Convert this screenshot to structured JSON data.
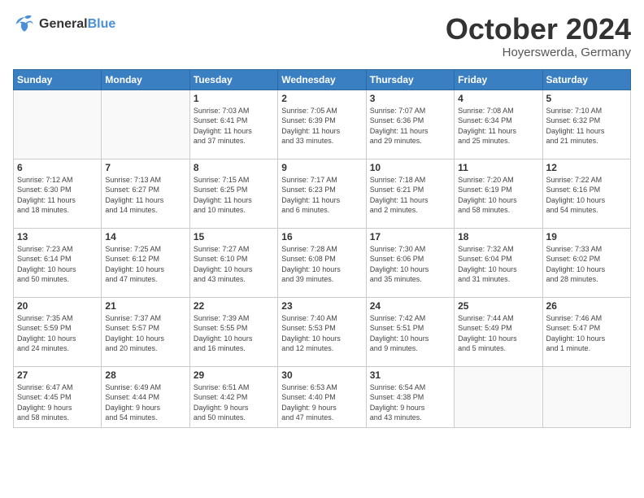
{
  "header": {
    "logo_line1": "General",
    "logo_line2": "Blue",
    "month": "October 2024",
    "location": "Hoyerswerda, Germany"
  },
  "days_of_week": [
    "Sunday",
    "Monday",
    "Tuesday",
    "Wednesday",
    "Thursday",
    "Friday",
    "Saturday"
  ],
  "weeks": [
    [
      {
        "day": "",
        "info": ""
      },
      {
        "day": "",
        "info": ""
      },
      {
        "day": "1",
        "info": "Sunrise: 7:03 AM\nSunset: 6:41 PM\nDaylight: 11 hours\nand 37 minutes."
      },
      {
        "day": "2",
        "info": "Sunrise: 7:05 AM\nSunset: 6:39 PM\nDaylight: 11 hours\nand 33 minutes."
      },
      {
        "day": "3",
        "info": "Sunrise: 7:07 AM\nSunset: 6:36 PM\nDaylight: 11 hours\nand 29 minutes."
      },
      {
        "day": "4",
        "info": "Sunrise: 7:08 AM\nSunset: 6:34 PM\nDaylight: 11 hours\nand 25 minutes."
      },
      {
        "day": "5",
        "info": "Sunrise: 7:10 AM\nSunset: 6:32 PM\nDaylight: 11 hours\nand 21 minutes."
      }
    ],
    [
      {
        "day": "6",
        "info": "Sunrise: 7:12 AM\nSunset: 6:30 PM\nDaylight: 11 hours\nand 18 minutes."
      },
      {
        "day": "7",
        "info": "Sunrise: 7:13 AM\nSunset: 6:27 PM\nDaylight: 11 hours\nand 14 minutes."
      },
      {
        "day": "8",
        "info": "Sunrise: 7:15 AM\nSunset: 6:25 PM\nDaylight: 11 hours\nand 10 minutes."
      },
      {
        "day": "9",
        "info": "Sunrise: 7:17 AM\nSunset: 6:23 PM\nDaylight: 11 hours\nand 6 minutes."
      },
      {
        "day": "10",
        "info": "Sunrise: 7:18 AM\nSunset: 6:21 PM\nDaylight: 11 hours\nand 2 minutes."
      },
      {
        "day": "11",
        "info": "Sunrise: 7:20 AM\nSunset: 6:19 PM\nDaylight: 10 hours\nand 58 minutes."
      },
      {
        "day": "12",
        "info": "Sunrise: 7:22 AM\nSunset: 6:16 PM\nDaylight: 10 hours\nand 54 minutes."
      }
    ],
    [
      {
        "day": "13",
        "info": "Sunrise: 7:23 AM\nSunset: 6:14 PM\nDaylight: 10 hours\nand 50 minutes."
      },
      {
        "day": "14",
        "info": "Sunrise: 7:25 AM\nSunset: 6:12 PM\nDaylight: 10 hours\nand 47 minutes."
      },
      {
        "day": "15",
        "info": "Sunrise: 7:27 AM\nSunset: 6:10 PM\nDaylight: 10 hours\nand 43 minutes."
      },
      {
        "day": "16",
        "info": "Sunrise: 7:28 AM\nSunset: 6:08 PM\nDaylight: 10 hours\nand 39 minutes."
      },
      {
        "day": "17",
        "info": "Sunrise: 7:30 AM\nSunset: 6:06 PM\nDaylight: 10 hours\nand 35 minutes."
      },
      {
        "day": "18",
        "info": "Sunrise: 7:32 AM\nSunset: 6:04 PM\nDaylight: 10 hours\nand 31 minutes."
      },
      {
        "day": "19",
        "info": "Sunrise: 7:33 AM\nSunset: 6:02 PM\nDaylight: 10 hours\nand 28 minutes."
      }
    ],
    [
      {
        "day": "20",
        "info": "Sunrise: 7:35 AM\nSunset: 5:59 PM\nDaylight: 10 hours\nand 24 minutes."
      },
      {
        "day": "21",
        "info": "Sunrise: 7:37 AM\nSunset: 5:57 PM\nDaylight: 10 hours\nand 20 minutes."
      },
      {
        "day": "22",
        "info": "Sunrise: 7:39 AM\nSunset: 5:55 PM\nDaylight: 10 hours\nand 16 minutes."
      },
      {
        "day": "23",
        "info": "Sunrise: 7:40 AM\nSunset: 5:53 PM\nDaylight: 10 hours\nand 12 minutes."
      },
      {
        "day": "24",
        "info": "Sunrise: 7:42 AM\nSunset: 5:51 PM\nDaylight: 10 hours\nand 9 minutes."
      },
      {
        "day": "25",
        "info": "Sunrise: 7:44 AM\nSunset: 5:49 PM\nDaylight: 10 hours\nand 5 minutes."
      },
      {
        "day": "26",
        "info": "Sunrise: 7:46 AM\nSunset: 5:47 PM\nDaylight: 10 hours\nand 1 minute."
      }
    ],
    [
      {
        "day": "27",
        "info": "Sunrise: 6:47 AM\nSunset: 4:45 PM\nDaylight: 9 hours\nand 58 minutes."
      },
      {
        "day": "28",
        "info": "Sunrise: 6:49 AM\nSunset: 4:44 PM\nDaylight: 9 hours\nand 54 minutes."
      },
      {
        "day": "29",
        "info": "Sunrise: 6:51 AM\nSunset: 4:42 PM\nDaylight: 9 hours\nand 50 minutes."
      },
      {
        "day": "30",
        "info": "Sunrise: 6:53 AM\nSunset: 4:40 PM\nDaylight: 9 hours\nand 47 minutes."
      },
      {
        "day": "31",
        "info": "Sunrise: 6:54 AM\nSunset: 4:38 PM\nDaylight: 9 hours\nand 43 minutes."
      },
      {
        "day": "",
        "info": ""
      },
      {
        "day": "",
        "info": ""
      }
    ]
  ]
}
